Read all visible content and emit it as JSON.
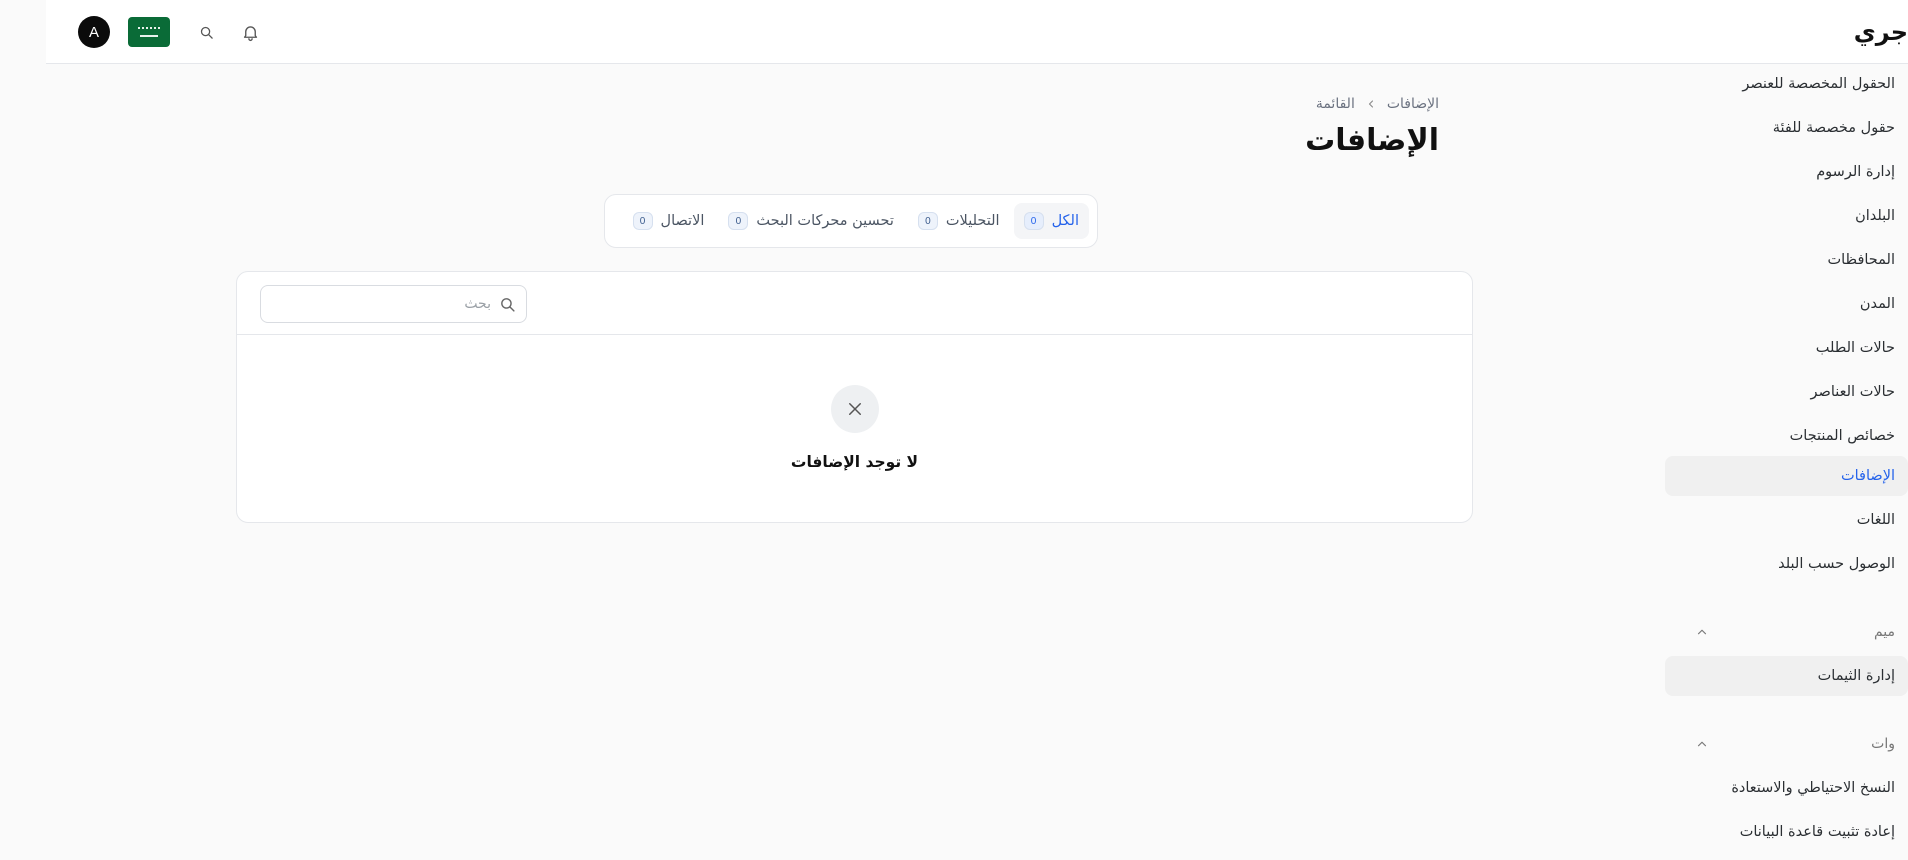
{
  "header": {
    "brand": "جري",
    "avatar_initial": "A",
    "icons": [
      "notification-bell-icon",
      "search-icon",
      "saudi-flag-icon"
    ]
  },
  "sidebar": {
    "items_top": [
      {
        "label": "الحقول المخصصة للعنصر"
      },
      {
        "label": "حقول مخصصة للفئة"
      },
      {
        "label": "إدارة الرسوم"
      },
      {
        "label": "البلدان"
      },
      {
        "label": "المحافظات"
      },
      {
        "label": "المدن"
      },
      {
        "label": "حالات الطلب"
      },
      {
        "label": "حالات العناصر"
      },
      {
        "label": "خصائص المنتجات"
      },
      {
        "label": "الإضافات",
        "active": true
      },
      {
        "label": "اللغات"
      },
      {
        "label": "الوصول حسب البلد"
      }
    ],
    "section_design": {
      "title": "ميم",
      "items": [
        {
          "label": "إدارة الثيمات"
        }
      ]
    },
    "section_tools": {
      "title": "وات",
      "items": [
        {
          "label": "النسخ الاحتياطي والاستعادة"
        },
        {
          "label": "إعادة تثبيت قاعدة البيانات"
        }
      ]
    }
  },
  "breadcrumb": {
    "root": "الإضافات",
    "current": "القائمة"
  },
  "page": {
    "title": "الإضافات"
  },
  "tabs": [
    {
      "label": "الكل",
      "count": "0",
      "active": true
    },
    {
      "label": "التحليلات",
      "count": "0"
    },
    {
      "label": "تحسين محركات البحث",
      "count": "0"
    },
    {
      "label": "الاتصال",
      "count": "0"
    }
  ],
  "search": {
    "placeholder": "بحث",
    "value": ""
  },
  "empty_state": {
    "message": "لا توجد الإضافات"
  },
  "colors": {
    "accent": "#2563eb",
    "flag_green": "#0a6b37",
    "background": "#fafafa",
    "border": "#e5e7eb"
  }
}
